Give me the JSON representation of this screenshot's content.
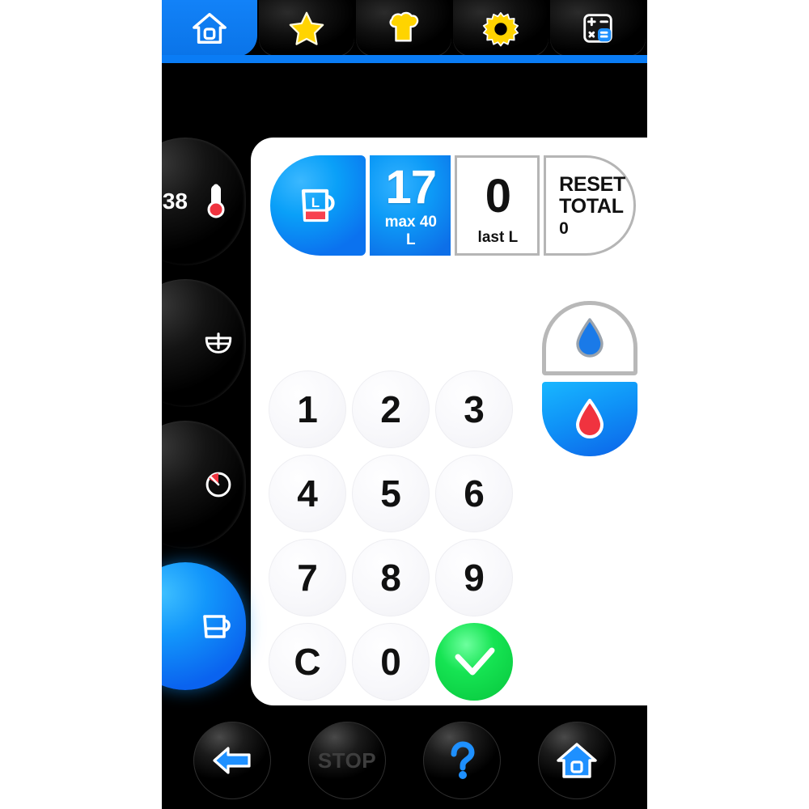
{
  "tabs": [
    {
      "name": "home",
      "icon": "home-icon",
      "active": true
    },
    {
      "name": "favorites",
      "icon": "star-icon",
      "active": false
    },
    {
      "name": "recipes",
      "icon": "chef-hat-icon",
      "active": false
    },
    {
      "name": "settings",
      "icon": "gear-icon",
      "active": false
    },
    {
      "name": "calculator",
      "icon": "calculator-icon",
      "active": false
    }
  ],
  "readout": {
    "mode_icon": "measuring-jug-icon",
    "amount": {
      "value": "17",
      "label": "max 40 L"
    },
    "last": {
      "value": "0",
      "label": "last L"
    },
    "reset": {
      "line1": "RESET",
      "line2": "TOTAL",
      "line3": "0"
    }
  },
  "keypad": {
    "keys": [
      {
        "label": "1",
        "type": "digit"
      },
      {
        "label": "2",
        "type": "digit"
      },
      {
        "label": "3",
        "type": "digit"
      },
      {
        "label": "4",
        "type": "digit"
      },
      {
        "label": "5",
        "type": "digit"
      },
      {
        "label": "6",
        "type": "digit"
      },
      {
        "label": "7",
        "type": "digit"
      },
      {
        "label": "8",
        "type": "digit"
      },
      {
        "label": "9",
        "type": "digit"
      },
      {
        "label": "C",
        "type": "clear"
      },
      {
        "label": "0",
        "type": "digit"
      },
      {
        "label": "",
        "type": "confirm",
        "icon": "checkmark-icon"
      }
    ]
  },
  "water": {
    "cold": {
      "icon": "cold-water-drop-icon",
      "active": false
    },
    "hot": {
      "icon": "hot-water-drop-icon",
      "active": true
    }
  },
  "sidebar": {
    "items": [
      {
        "name": "temperature",
        "icon": "thermometer-icon",
        "value": "38",
        "active": false
      },
      {
        "name": "mixing",
        "icon": "mixing-bowl-icon",
        "value": "",
        "active": false
      },
      {
        "name": "timer",
        "icon": "timer-icon",
        "value": "",
        "active": false
      },
      {
        "name": "water-jug",
        "icon": "jug-icon",
        "value": "",
        "active": true
      }
    ]
  },
  "bottom_nav": [
    {
      "name": "back",
      "icon": "back-arrow-icon",
      "label": ""
    },
    {
      "name": "stop",
      "icon": "",
      "label": "STOP"
    },
    {
      "name": "help",
      "icon": "question-mark-icon",
      "label": ""
    },
    {
      "name": "home",
      "icon": "home-icon",
      "label": ""
    }
  ],
  "colors": {
    "accent_blue": "#0a7cf5",
    "frame_black": "#000000",
    "panel_white": "#ffffff",
    "icon_yellow": "#ffd400",
    "confirm_green": "#16e453",
    "hot_red": "#f03a46",
    "border_gray": "#b5b5b5"
  }
}
